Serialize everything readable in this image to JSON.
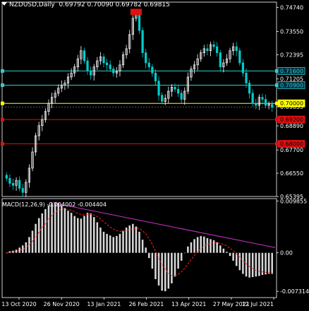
{
  "header": {
    "symbol": "NZDUSD,Daily",
    "ohlc": "0.69792 0.70090 0.69782 0.69815"
  },
  "macd": {
    "label": "MACD(12,26,9) -0.004002 -0.004404"
  },
  "colors": {
    "background": "#000000",
    "bull": "#ffffff",
    "bear": "#00cccc",
    "grid": "#ffffff",
    "trendline": "#cc33cc",
    "signal": "#ff2222",
    "level_cyan": "#33cccc",
    "level_yellow": "#ffff00",
    "level_red": "#dd1111"
  },
  "chart_data": [
    {
      "type": "candlestick",
      "title": "NZDUSD,Daily",
      "ylim": [
        0.654,
        0.75
      ],
      "y_ticks": [
        "0.74740",
        "0.73550",
        "0.72395",
        "0.71205",
        "0.69835",
        "0.68890",
        "0.67700",
        "0.66550",
        "0.65395"
      ],
      "x_ticks": [
        "13 Oct 2020",
        "26 Nov 2020",
        "13 Jan 2021",
        "26 Feb 2021",
        "13 Apr 2021",
        "27 May 2021",
        "12 Jul 2021"
      ],
      "levels": [
        {
          "label": "0.71600",
          "value": 0.716,
          "color": "cyan"
        },
        {
          "label": "0.70900",
          "value": 0.709,
          "color": "cyan"
        },
        {
          "label": "0.70000",
          "value": 0.7,
          "color": "yellow"
        },
        {
          "label": "0.69200",
          "value": 0.692,
          "color": "red"
        },
        {
          "label": "0.68000",
          "value": 0.68,
          "color": "red"
        }
      ],
      "current_price": "0.69815",
      "high_marker": {
        "value": 0.7474
      },
      "close_series": [
        0.663,
        0.6605,
        0.6595,
        0.662,
        0.658,
        0.656,
        0.661,
        0.668,
        0.676,
        0.684,
        0.689,
        0.692,
        0.696,
        0.7,
        0.703,
        0.705,
        0.7075,
        0.709,
        0.71,
        0.713,
        0.715,
        0.718,
        0.722,
        0.726,
        0.721,
        0.716,
        0.714,
        0.718,
        0.721,
        0.723,
        0.72,
        0.719,
        0.717,
        0.715,
        0.716,
        0.719,
        0.724,
        0.727,
        0.734,
        0.742,
        0.744,
        0.736,
        0.725,
        0.72,
        0.718,
        0.715,
        0.711,
        0.704,
        0.701,
        0.7025,
        0.706,
        0.708,
        0.707,
        0.705,
        0.702,
        0.706,
        0.713,
        0.717,
        0.719,
        0.722,
        0.725,
        0.727,
        0.726,
        0.729,
        0.728,
        0.725,
        0.718,
        0.72,
        0.722,
        0.726,
        0.728,
        0.726,
        0.72,
        0.715,
        0.71,
        0.705,
        0.7,
        0.699,
        0.703,
        0.702,
        0.699,
        0.6995,
        0.6981
      ]
    },
    {
      "type": "bar",
      "title": "MACD(12,26,9) -0.004002 -0.004404",
      "ylim": [
        -0.0085,
        0.0103
      ],
      "y_ticks": [
        "0.009855",
        "0.00",
        "-0.007314"
      ],
      "series": [
        {
          "name": "MACD",
          "values": [
            0.0,
            0.0003,
            0.0004,
            0.0006,
            0.001,
            0.0014,
            0.002,
            0.003,
            0.0042,
            0.0055,
            0.0066,
            0.0075,
            0.0083,
            0.009,
            0.0094,
            0.0096,
            0.0095,
            0.009,
            0.0085,
            0.008,
            0.0076,
            0.007,
            0.0066,
            0.0065,
            0.007,
            0.0076,
            0.0075,
            0.0068,
            0.0058,
            0.0048,
            0.004,
            0.0036,
            0.0033,
            0.003,
            0.0032,
            0.0036,
            0.0042,
            0.0048,
            0.0052,
            0.0055,
            0.005,
            0.004,
            0.0025,
            0.001,
            -0.001,
            -0.003,
            -0.005,
            -0.0062,
            -0.0072,
            -0.0073,
            -0.0068,
            -0.0058,
            -0.0045,
            -0.003,
            -0.0015,
            0.0,
            0.0012,
            0.002,
            0.0026,
            0.003,
            0.0032,
            0.0031,
            0.0028,
            0.0026,
            0.0024,
            0.002,
            0.0014,
            0.0008,
            0.0002,
            -0.0006,
            -0.0015,
            -0.0025,
            -0.0033,
            -0.004,
            -0.0045,
            -0.0047,
            -0.0046,
            -0.0045,
            -0.0044,
            -0.0042,
            -0.0041,
            -0.004,
            -0.004
          ]
        },
        {
          "name": "Signal",
          "values": [
            0.0,
            0.0001,
            0.0002,
            0.0003,
            0.0005,
            0.0007,
            0.001,
            0.0015,
            0.0022,
            0.003,
            0.0039,
            0.0048,
            0.0056,
            0.0064,
            0.0071,
            0.0077,
            0.0081,
            0.0083,
            0.0083,
            0.0082,
            0.0081,
            0.0078,
            0.0075,
            0.0073,
            0.0072,
            0.0073,
            0.0073,
            0.0072,
            0.0069,
            0.0064,
            0.0059,
            0.0054,
            0.0049,
            0.0045,
            0.0042,
            0.0041,
            0.0041,
            0.0042,
            0.0044,
            0.0046,
            0.0047,
            0.0046,
            0.0042,
            0.0036,
            0.0027,
            0.0016,
            0.0003,
            -0.001,
            -0.0022,
            -0.0032,
            -0.0039,
            -0.0043,
            -0.0043,
            -0.0041,
            -0.0036,
            -0.0029,
            -0.0021,
            -0.0013,
            -0.0005,
            0.0002,
            0.0008,
            0.0013,
            0.0016,
            0.0018,
            0.0019,
            0.0019,
            0.0018,
            0.0016,
            0.0013,
            0.0009,
            0.0004,
            -0.0002,
            -0.0008,
            -0.0015,
            -0.0021,
            -0.0026,
            -0.003,
            -0.0033,
            -0.0035,
            -0.0036,
            -0.0037,
            -0.0038,
            -0.0038
          ]
        }
      ]
    }
  ]
}
